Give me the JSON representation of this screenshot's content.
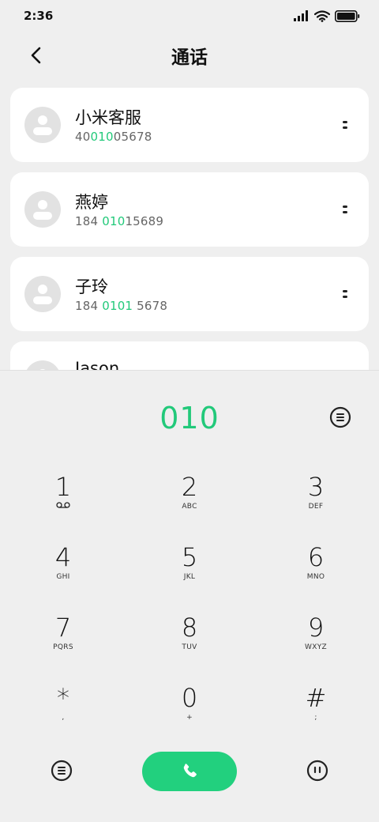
{
  "status_bar": {
    "time": "2:36",
    "icons": [
      "signal-icon",
      "wifi-icon",
      "battery-icon"
    ]
  },
  "header": {
    "title": "通话",
    "back_icon": "back-arrow-icon"
  },
  "contacts": [
    {
      "name": "小米客服",
      "number_pre": "40",
      "number_hl": "010",
      "number_post": "05678"
    },
    {
      "name": "燕婷",
      "number_pre": "184 ",
      "number_hl": "010",
      "number_post": "15689"
    },
    {
      "name": "子玲",
      "number_pre": "184 ",
      "number_hl": "0101",
      "number_post": " 5678"
    },
    {
      "name": "Jason",
      "number_pre": "",
      "number_hl": "",
      "number_post": ""
    }
  ],
  "dialer": {
    "input": "010",
    "keys": [
      {
        "digit": "1",
        "sub": ""
      },
      {
        "digit": "2",
        "sub": "ABC"
      },
      {
        "digit": "3",
        "sub": "DEF"
      },
      {
        "digit": "4",
        "sub": "GHI"
      },
      {
        "digit": "5",
        "sub": "JKL"
      },
      {
        "digit": "6",
        "sub": "MNO"
      },
      {
        "digit": "7",
        "sub": "PQRS"
      },
      {
        "digit": "8",
        "sub": "TUV"
      },
      {
        "digit": "9",
        "sub": "WXYZ"
      },
      {
        "digit": "*",
        "sub": ","
      },
      {
        "digit": "0",
        "sub": "+"
      },
      {
        "digit": "#",
        "sub": ";"
      }
    ]
  },
  "colors": {
    "accent": "#22c97a",
    "call_button": "#22d07e",
    "background": "#efefef"
  }
}
